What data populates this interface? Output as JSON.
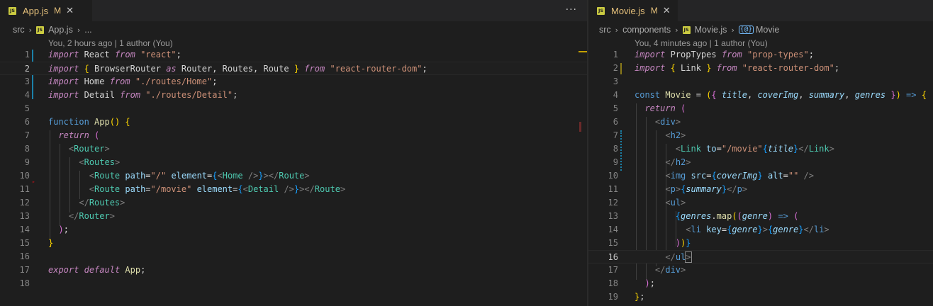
{
  "left": {
    "tab": {
      "name": "App.js",
      "status": "M",
      "close": "✕"
    },
    "more_actions": "···",
    "breadcrumb": {
      "folder": "src",
      "file": "App.js",
      "more": "..."
    },
    "blame": "You, 2 hours ago | 1 author (You)"
  },
  "right": {
    "tab": {
      "name": "Movie.js",
      "status": "M",
      "close": "✕"
    },
    "breadcrumb": {
      "folder1": "src",
      "folder2": "components",
      "file": "Movie.js",
      "symbol_icon": "{@}",
      "symbol": "Movie"
    },
    "blame": "You, 4 minutes ago | 1 author (You)"
  },
  "icons": {
    "js_file_icon": "JS",
    "chevron": "›"
  },
  "colors": {
    "keyword": "#c586c0",
    "declaration": "#569cd6",
    "string": "#ce9178",
    "function": "#dcdcaa",
    "attribute": "#9cdcfe",
    "modified_tab": "#e5c07b"
  }
}
